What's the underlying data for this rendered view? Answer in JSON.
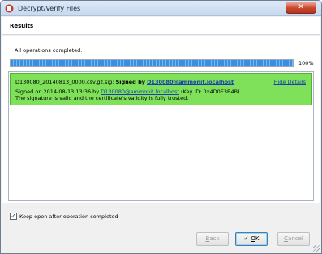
{
  "window": {
    "title": "Decrypt/Verify Files",
    "close_label": "✕"
  },
  "header": {
    "title": "Results"
  },
  "status": {
    "text": "All operations completed.",
    "progress_percent": 100,
    "progress_label": "100%"
  },
  "result": {
    "filename_text": "D130080_20140813_0000.csv.gz.sig:",
    "signed_by_label": "Signed by",
    "signer": "D130080@ammonit.localhost",
    "hide_details": "Hide Details",
    "detail_prefix": "Signed on 2014-08-13 13:36 by",
    "detail_signer": "D130080@ammonit.localhost",
    "detail_suffix": "(Key ID: 0x4D0E3B4B).",
    "validity": "The signature is valid and the certificate's validity is fully trusted.",
    "status_color": "#7fe05a"
  },
  "options": {
    "keep_open_label": "Keep open after operation completed",
    "keep_open_checked": true
  },
  "buttons": {
    "back_mnemonic": "B",
    "back_rest": "ack",
    "ok_mnemonic": "O",
    "ok_rest": "K",
    "cancel_mnemonic": "C",
    "cancel_rest": "ancel"
  }
}
